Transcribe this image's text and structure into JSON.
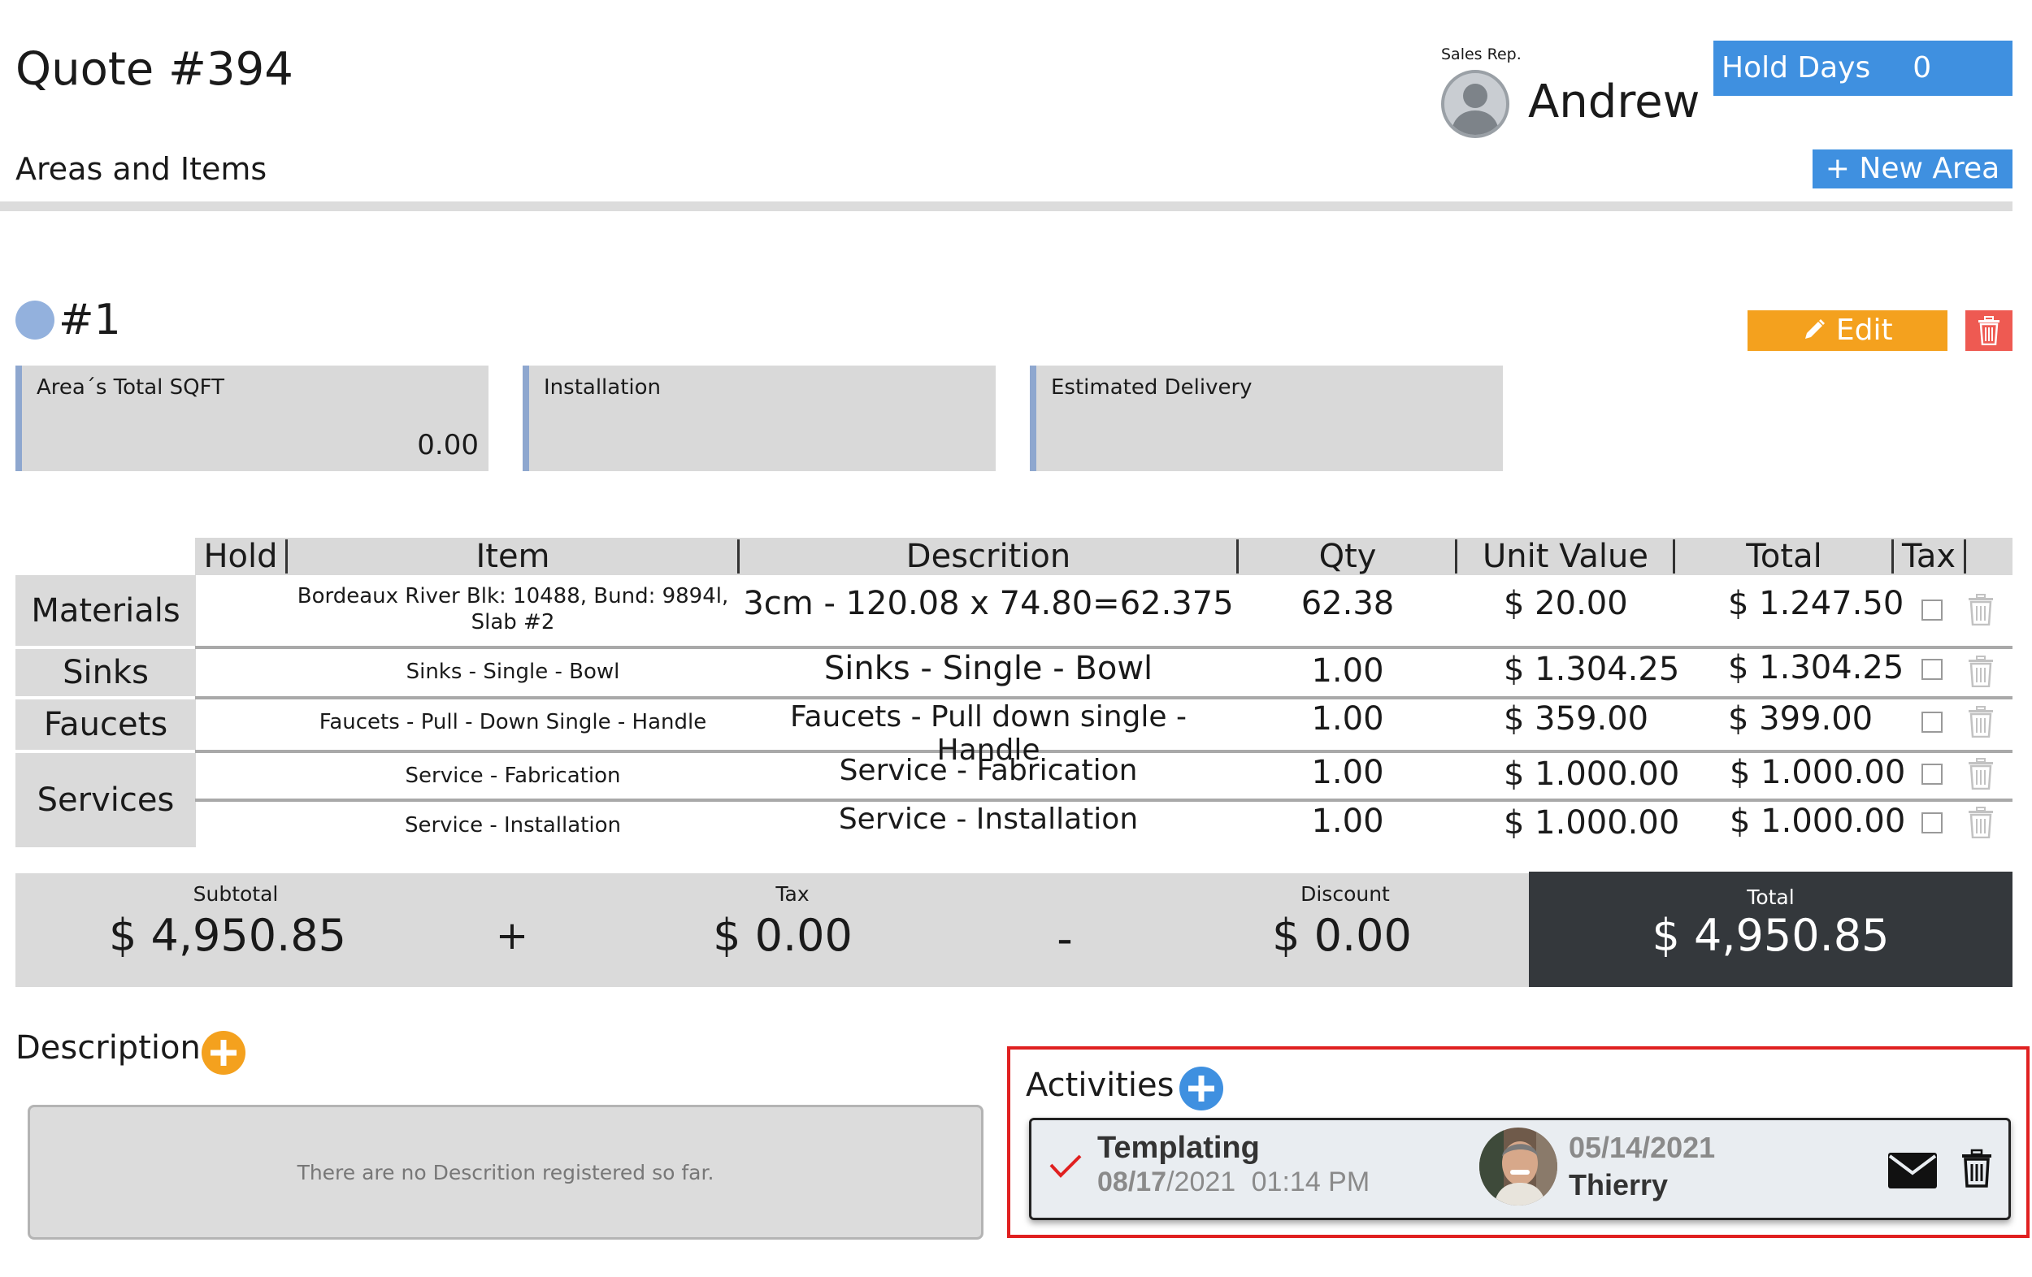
{
  "header": {
    "quote_title": "Quote #394",
    "section_title": "Areas and Items",
    "sales_rep_label": "Sales Rep.",
    "sales_rep_name": "Andrew",
    "hold_days_label": "Hold Days",
    "hold_days_value": "0",
    "new_area_label": "+ New Area"
  },
  "area": {
    "number": "#1",
    "edit_label": "Edit",
    "cards": [
      {
        "label": "Area´s Total SQFT",
        "value": "0.00"
      },
      {
        "label": "Installation",
        "value": ""
      },
      {
        "label": "Estimated Delivery",
        "value": ""
      }
    ]
  },
  "table": {
    "columns": [
      "Hold",
      "Item",
      "Descrition",
      "Qty",
      "Unit Value",
      "Total",
      "Tax"
    ],
    "categories": [
      "Materials",
      "Sinks",
      "Faucets",
      "Services"
    ],
    "rows": [
      {
        "item_line1": "Bordeaux River Blk: 10488, Bund: 9894l,",
        "item_line2": "Slab #2",
        "description": "3cm - 120.08 x 74.80=62.375",
        "qty": "62.38",
        "unit": "$ 20.00",
        "total": "$ 1.247.50"
      },
      {
        "item_line1": "Sinks - Single - Bowl",
        "item_line2": "",
        "description": "Sinks - Single - Bowl",
        "qty": "1.00",
        "unit": "$ 1.304.25",
        "total": "$ 1.304.25"
      },
      {
        "item_line1": "Faucets - Pull - Down Single - Handle",
        "item_line2": "",
        "description": "Faucets - Pull down single - Handle",
        "qty": "1.00",
        "unit": "$ 359.00",
        "total": "$ 399.00"
      },
      {
        "item_line1": "Service - Fabrication",
        "item_line2": "",
        "description": "Service - Fabrication",
        "qty": "1.00",
        "unit": "$ 1.000.00",
        "total": "$ 1.000.00"
      },
      {
        "item_line1": "Service - Installation",
        "item_line2": "",
        "description": "Service - Installation",
        "qty": "1.00",
        "unit": "$ 1.000.00",
        "total": "$ 1.000.00"
      }
    ]
  },
  "totals": {
    "subtotal_label": "Subtotal",
    "subtotal_value": "$ 4,950.85",
    "plus": "+",
    "tax_label": "Tax",
    "tax_value": "$ 0.00",
    "minus": "-",
    "discount_label": "Discount",
    "discount_value": "$ 0.00",
    "total_label": "Total",
    "total_value": "$ 4,950.85"
  },
  "description": {
    "title": "Description",
    "empty_text": "There are no Descrition registered so far."
  },
  "activities": {
    "title": "Activities",
    "item": {
      "title": "Templating",
      "date_part1": "08/17",
      "date_part2": "/2021",
      "time": "01:14 PM",
      "due_date": "05/14/2021",
      "user": "Thierry"
    }
  },
  "colors": {
    "accent_blue": "#3f90e0",
    "edit_orange": "#f4a11e",
    "delete_red": "#ee5a52",
    "dark_total": "#34383c",
    "highlight_red": "#e02020"
  }
}
